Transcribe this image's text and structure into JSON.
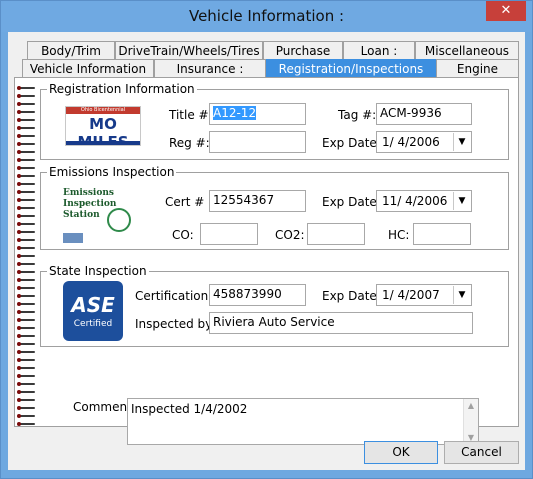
{
  "window": {
    "title": "Vehicle Information :",
    "close": "✕"
  },
  "tabs": {
    "row1": [
      "Body/Trim",
      "DriveTrain/Wheels/Tires",
      "Purchase",
      "Loan :",
      "Miscellaneous"
    ],
    "row2": [
      "Vehicle Information",
      "Insurance :",
      "Registration/Inspections",
      "Engine"
    ],
    "active": "Registration/Inspections"
  },
  "registration": {
    "legend": "Registration Information",
    "plate_text": "MO MILES",
    "plate_top": "Ohio Bicentennial",
    "title_label": "Title #:",
    "title_value": "A12-12",
    "tag_label": "Tag #:",
    "tag_value": "ACM-9936",
    "reg_label": "Reg #:",
    "reg_value": "",
    "exp_label": "Exp Date:",
    "exp_value": "1/  4/2006"
  },
  "emissions": {
    "legend": "Emissions Inspection",
    "logo_line1": "Emissions",
    "logo_line2": "Inspection",
    "logo_line3": "Station",
    "cert_label": "Cert # :",
    "cert_value": "12554367",
    "exp_label": "Exp Date:",
    "exp_value": "11/  4/2006",
    "co_label": "CO:",
    "co_value": "",
    "co2_label": "CO2:",
    "co2_value": "",
    "hc_label": "HC:",
    "hc_value": ""
  },
  "state": {
    "legend": "State Inspection",
    "logo_text": "ASE",
    "logo_sub": "Certified",
    "cert_label": "Certification #:",
    "cert_value": "458873990",
    "exp_label": "Exp Date:",
    "exp_value": "1/  4/2007",
    "insp_label": "Inspected by :",
    "insp_value": "Riviera Auto Service"
  },
  "comment": {
    "label": "Comment:",
    "value": "Inspected 1/4/2002"
  },
  "buttons": {
    "ok": "OK",
    "cancel": "Cancel"
  },
  "icons": {
    "dropdown": "▼",
    "scroll_up": "▲",
    "scroll_down": "▼"
  }
}
